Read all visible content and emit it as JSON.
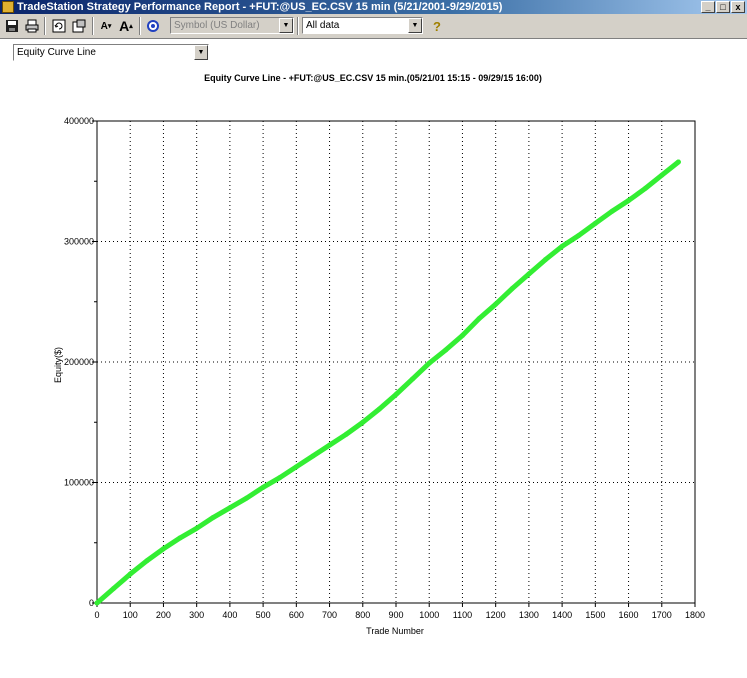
{
  "window": {
    "title": "TradeStation Strategy Performance Report - +FUT:@US_EC.CSV 15 min (5/21/2001-9/29/2015)",
    "min": "_",
    "max": "□",
    "close": "x"
  },
  "toolbar": {
    "save_icon": "save-icon",
    "print_icon": "print-icon",
    "refresh_icon": "refresh-icon",
    "export_icon": "export-icon",
    "font_smaller_label": "A",
    "font_larger_label": "A",
    "currency_select": {
      "value": "Symbol (US Dollar)"
    },
    "data_range_select": {
      "value": "All data"
    },
    "help_label": "?"
  },
  "view_select": {
    "value": "Equity Curve Line"
  },
  "chart_data": {
    "type": "line",
    "title": "Equity Curve Line - +FUT:@US_EC.CSV 15 min.(05/21/01 15:15 - 09/29/15 16:00)",
    "xlabel": "Trade Number",
    "ylabel": "Equity($)",
    "xlim": [
      0,
      1800
    ],
    "ylim": [
      0,
      400000
    ],
    "xticks": [
      0,
      100,
      200,
      300,
      400,
      500,
      600,
      700,
      800,
      900,
      1000,
      1100,
      1200,
      1300,
      1400,
      1500,
      1600,
      1700,
      1800
    ],
    "yticks": [
      0,
      100000,
      200000,
      300000,
      400000
    ],
    "grid": true,
    "line_color": "#33ee33",
    "series": [
      {
        "x": [
          0,
          50,
          100,
          150,
          200,
          250,
          300,
          350,
          400,
          450,
          500,
          550,
          600,
          650,
          700,
          750,
          800,
          850,
          900,
          950,
          1000,
          1050,
          1100,
          1150,
          1200,
          1250,
          1300,
          1350,
          1400,
          1450,
          1500,
          1550,
          1600,
          1650,
          1700,
          1750
        ],
        "values": [
          0,
          12000,
          24000,
          35000,
          45000,
          54000,
          62000,
          71000,
          79000,
          87000,
          96000,
          104000,
          113000,
          122000,
          131000,
          140000,
          150000,
          161000,
          173000,
          186000,
          199000,
          210000,
          222000,
          236000,
          248000,
          261000,
          273000,
          285000,
          296000,
          305000,
          315000,
          325000,
          334000,
          344000,
          355000,
          366000
        ]
      }
    ]
  }
}
